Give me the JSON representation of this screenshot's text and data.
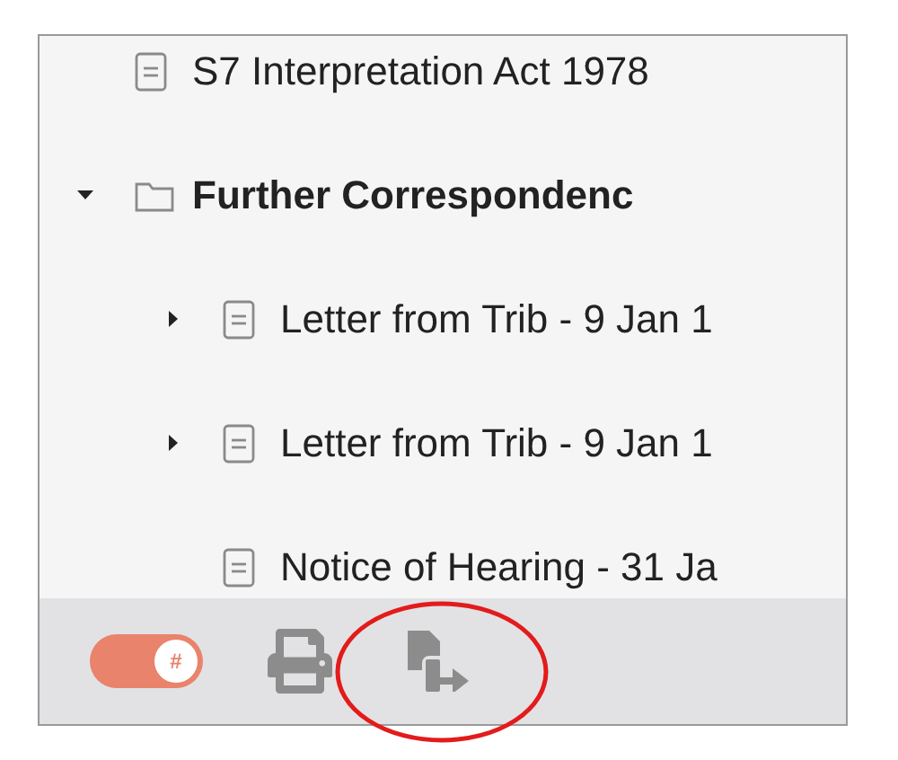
{
  "tree": [
    {
      "label": "S7 Interpretation Act 1978",
      "kind": "document"
    },
    {
      "label": "Further Correspondenc",
      "kind": "folder",
      "expanded": true,
      "children": [
        {
          "label": "Letter from Trib - 9 Jan 1",
          "kind": "document",
          "expanded": false
        },
        {
          "label": "Letter from Trib - 9 Jan 1",
          "kind": "document",
          "expanded": false
        },
        {
          "label": "Notice of Hearing - 31 Ja",
          "kind": "document"
        }
      ]
    }
  ],
  "toolbar": {
    "toggle": {
      "on": true,
      "symbol": "#"
    }
  }
}
